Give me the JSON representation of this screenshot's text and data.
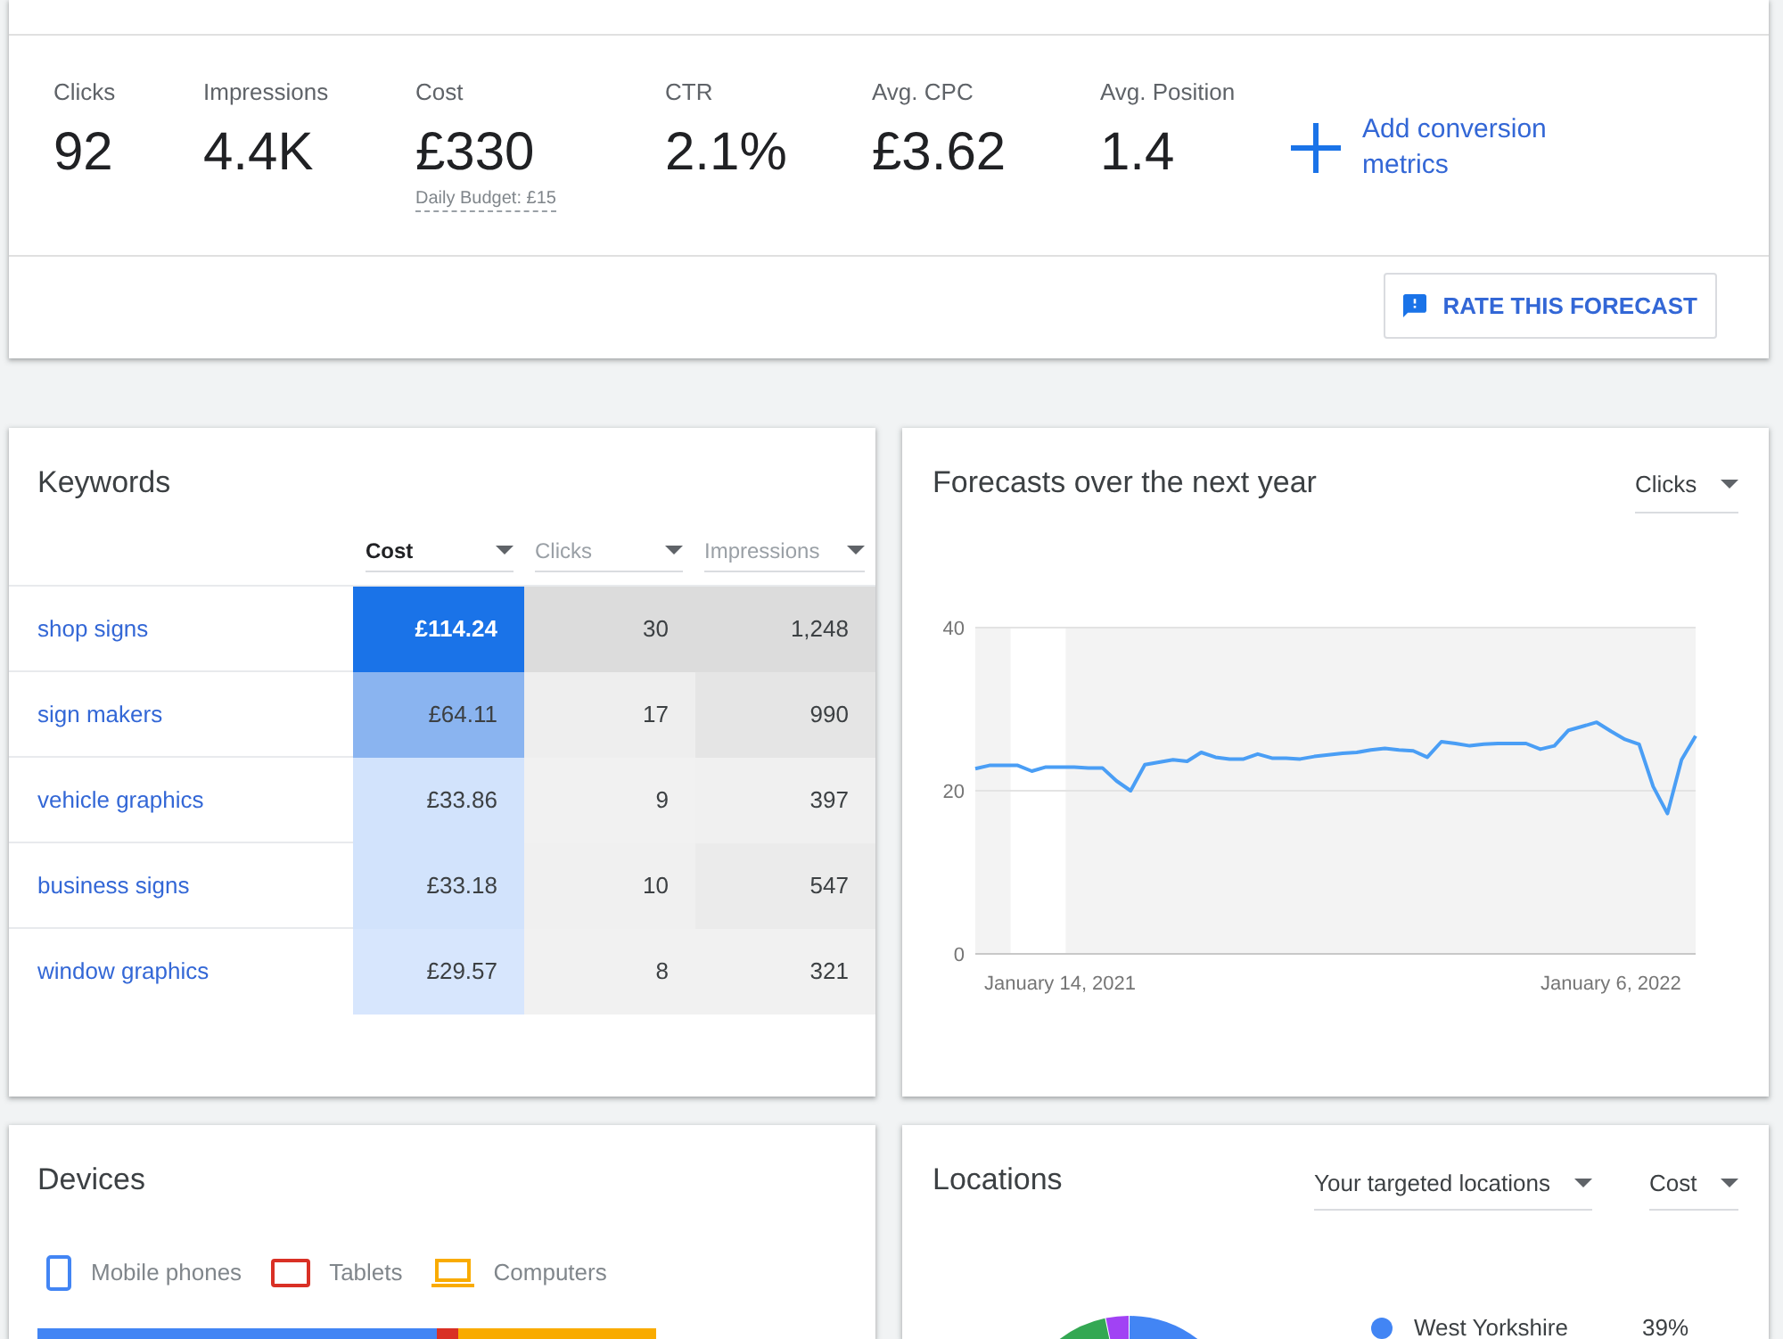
{
  "summary": {
    "metrics": [
      {
        "label": "Clicks",
        "value": "92"
      },
      {
        "label": "Impressions",
        "value": "4.4K"
      },
      {
        "label": "Cost",
        "value": "£330",
        "note": "Daily Budget: £15"
      },
      {
        "label": "CTR",
        "value": "2.1%"
      },
      {
        "label": "Avg. CPC",
        "value": "£3.62"
      },
      {
        "label": "Avg. Position",
        "value": "1.4"
      }
    ],
    "add_metrics_link": "Add conversion metrics",
    "rate_button": "RATE THIS FORECAST"
  },
  "keywords": {
    "title": "Keywords",
    "columns": [
      {
        "label": "Cost",
        "selected": true
      },
      {
        "label": "Clicks",
        "selected": false
      },
      {
        "label": "Impressions",
        "selected": false
      }
    ],
    "rows": [
      {
        "keyword": "shop signs",
        "cells": [
          {
            "value": "£114.24",
            "color": "#1a73e8"
          },
          {
            "value": "30",
            "color": "#dcdcdc"
          },
          {
            "value": "1,248",
            "color": "#dcdcdc"
          }
        ]
      },
      {
        "keyword": "sign makers",
        "cells": [
          {
            "value": "£64.11",
            "color": "#8ab4f0"
          },
          {
            "value": "17",
            "color": "#eeeeee"
          },
          {
            "value": "990",
            "color": "#e5e5e5"
          }
        ]
      },
      {
        "keyword": "vehicle graphics",
        "cells": [
          {
            "value": "£33.86",
            "color": "#d2e3fc"
          },
          {
            "value": "9",
            "color": "#f1f1f1"
          },
          {
            "value": "397",
            "color": "#f0f0f0"
          }
        ]
      },
      {
        "keyword": "business signs",
        "cells": [
          {
            "value": "£33.18",
            "color": "#d2e3fc"
          },
          {
            "value": "10",
            "color": "#f0f0f0"
          },
          {
            "value": "547",
            "color": "#ebebeb"
          }
        ]
      },
      {
        "keyword": "window graphics",
        "cells": [
          {
            "value": "£29.57",
            "color": "#d7e6fd"
          },
          {
            "value": "8",
            "color": "#f1f1f1"
          },
          {
            "value": "321",
            "color": "#f1f1f1"
          }
        ]
      }
    ]
  },
  "forecast": {
    "title": "Forecasts over the next year",
    "metric_dropdown": "Clicks",
    "chart_data": {
      "type": "line",
      "categories": [
        null,
        null,
        null,
        null,
        null,
        null,
        "January 14, 2021",
        null,
        null,
        null,
        null,
        null,
        null,
        null,
        null,
        null,
        null,
        null,
        null,
        null,
        null,
        null,
        null,
        null,
        null,
        null,
        null,
        null,
        null,
        null,
        null,
        null,
        null,
        null,
        null,
        null,
        null,
        null,
        null,
        null,
        null,
        null,
        null,
        null,
        null,
        "January 6, 2022",
        null,
        null,
        null,
        null,
        null,
        null
      ],
      "ylim": [
        0,
        40
      ],
      "yticks": [
        0,
        20,
        40
      ],
      "series": [
        {
          "color": "#4a9ef5",
          "values": [
            22.7,
            23.1,
            23.1,
            23.1,
            22.4,
            22.9,
            22.9,
            22.9,
            22.8,
            22.8,
            21.2,
            20.0,
            23.2,
            23.5,
            23.8,
            23.6,
            24.7,
            24.1,
            23.9,
            23.9,
            24.5,
            24.0,
            24.0,
            23.9,
            24.2,
            24.4,
            24.6,
            24.7,
            25.0,
            25.2,
            25.0,
            24.9,
            24.1,
            26.0,
            25.8,
            25.5,
            25.7,
            25.8,
            25.8,
            25.8,
            25.1,
            25.5,
            27.4,
            27.9,
            28.4,
            27.3,
            26.3,
            25.7,
            20.5,
            17.2,
            23.8,
            26.7
          ]
        }
      ]
    }
  },
  "devices": {
    "title": "Devices",
    "items": [
      {
        "kind": "mobile",
        "label": "Mobile phones",
        "color": "#4285f4"
      },
      {
        "kind": "tablet",
        "label": "Tablets",
        "color": "#d93025"
      },
      {
        "kind": "computer",
        "label": "Computers",
        "color": "#f9ab00"
      }
    ]
  },
  "locations": {
    "title": "Locations",
    "dropdowns": [
      "Your targeted locations",
      "Cost"
    ],
    "legend": [
      {
        "label": "West Yorkshire",
        "value": "39%",
        "color": "#4285f4"
      }
    ]
  }
}
